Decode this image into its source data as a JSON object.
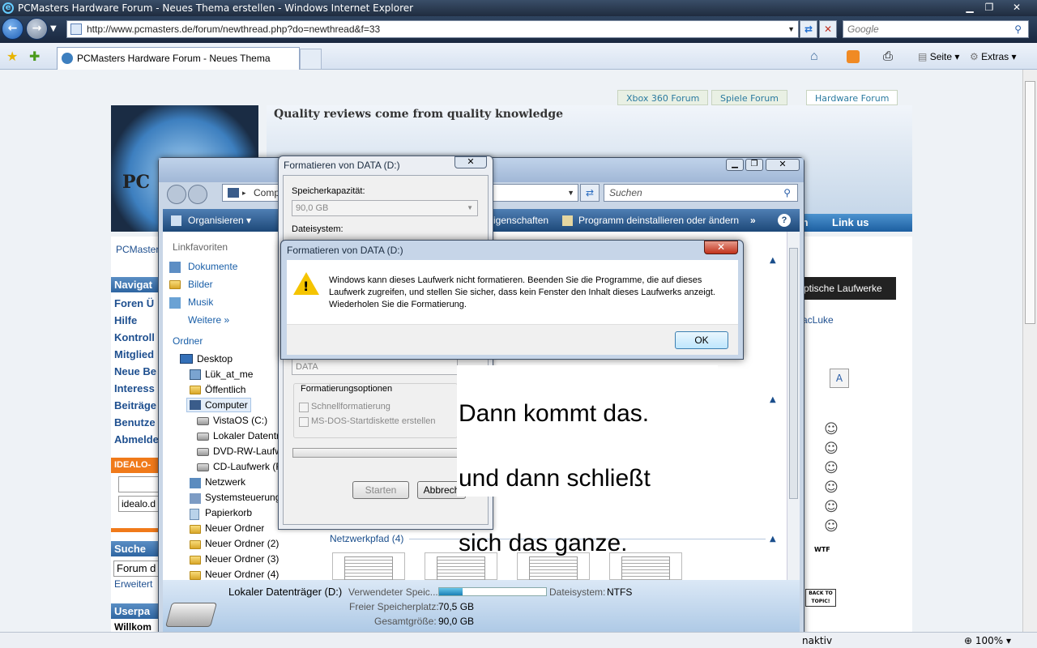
{
  "ie": {
    "window_title": "PCMasters Hardware Forum - Neues Thema erstellen - Windows Internet Explorer",
    "url": "http://www.pcmasters.de/forum/newthread.php?do=newthread&f=33",
    "search_placeholder": "Google",
    "tab_label": "PCMasters Hardware Forum - Neues Thema erste...",
    "cmd_page": "Seite",
    "cmd_tools": "Extras",
    "zoom": "100%",
    "status_text": "naktiv"
  },
  "site": {
    "tabs": [
      "Xbox 360 Forum",
      "Spiele Forum",
      "Hardware Forum"
    ],
    "slogan": "Quality reviews come from quality knowledge",
    "logo_text": "PC",
    "link_us": "Link us",
    "link_um": "m",
    "breadcrumb": "PCMaster",
    "nav_head": "Navigat",
    "nav_links": [
      "Foren Ü",
      "Hilfe",
      "Kontroll",
      "Mitglied",
      "Neue Be",
      "Interess",
      "Beiträge",
      "Benutze",
      "Abmelde"
    ],
    "idealo_head": "IDEALO-",
    "idealo_input": "idealo.d",
    "search_head": "Suche",
    "search_input": "Forum d",
    "search_ext": "Erweitert",
    "userpanel_head": "Userpa",
    "welcome": "Willkom",
    "right_head": "ptische Laufwerke",
    "right_user": "acLuke",
    "back_to_topic": "BACK TO TOPIC!",
    "wtf": "WTF"
  },
  "explorer": {
    "address_partial": "Comp",
    "search_placeholder": "Suchen",
    "toolbar_organize": "Organisieren",
    "toolbar_props": "igenschaften",
    "toolbar_uninstall": "Programm deinstallieren oder ändern",
    "favorites_head": "Linkfavoriten",
    "favorites": [
      "Dokumente",
      "Bilder",
      "Musik"
    ],
    "more": "Weitere",
    "folders_head": "Ordner",
    "tree": [
      "Desktop",
      "Lük_at_me",
      "Öffentlich",
      "Computer",
      "VistaOS (C:)",
      "Lokaler Datentr",
      "DVD-RW-Laufw",
      "CD-Laufwerk (F",
      "Netzwerk",
      "Systemsteuerung",
      "Papierkorb",
      "Neuer Ordner",
      "Neuer Ordner (2)",
      "Neuer Ordner (3)",
      "Neuer Ordner (4)"
    ],
    "network_group": "Netzwerkpfad (4)",
    "details": {
      "drive_name": "Lokaler Datenträger (D:)",
      "used_label": "Verwendeter Speic...",
      "used_fraction": 0.22,
      "fs_label": "Dateisystem:",
      "fs_value": "NTFS",
      "free_label": "Freier Speicherplatz:",
      "free_value": "70,5 GB",
      "total_label": "Gesamtgröße:",
      "total_value": "90,0 GB"
    }
  },
  "format_dialog": {
    "title": "Formatieren von DATA (D:)",
    "capacity_label": "Speicherkapazität:",
    "capacity_value": "90,0 GB",
    "fs_label": "Dateisystem:",
    "volume_value": "DATA",
    "options_label": "Formatierungsoptionen",
    "quick_format": "Schnellformatierung",
    "msdos": "MS-DOS-Startdiskette erstellen",
    "start_button": "Starten",
    "cancel_button": "Abbrech"
  },
  "error_dialog": {
    "title": "Formatieren von DATA (D:)",
    "message": "Windows kann dieses Laufwerk nicht formatieren. Beenden Sie die Programme, die auf dieses Laufwerk zugreifen, und stellen Sie sicher, dass kein Fenster den Inhalt dieses Laufwerks anzeigt. Wiederholen Sie die Formatierung.",
    "ok_button": "OK"
  },
  "annotation": [
    "Dann kommt das.",
    "und dann schließt",
    "sich das ganze."
  ]
}
